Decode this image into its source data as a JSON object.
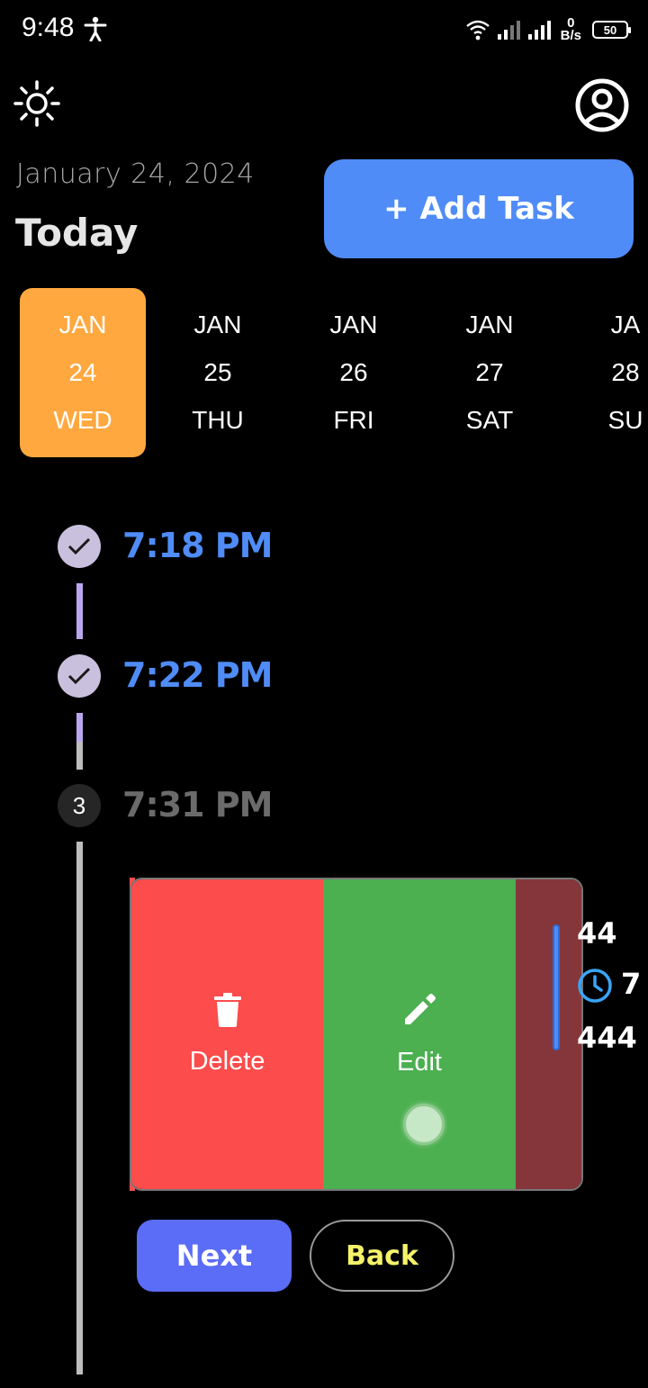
{
  "status_bar": {
    "time": "9:48",
    "net_speed_value": "0",
    "net_speed_unit": "B/s",
    "battery": "50"
  },
  "header": {
    "date": "January 24, 2024",
    "title": "Today",
    "add_task_label": "+ Add Task"
  },
  "date_strip": {
    "items": [
      {
        "month": "JAN",
        "day": "24",
        "weekday": "WED",
        "selected": true
      },
      {
        "month": "JAN",
        "day": "25",
        "weekday": "THU",
        "selected": false
      },
      {
        "month": "JAN",
        "day": "26",
        "weekday": "FRI",
        "selected": false
      },
      {
        "month": "JAN",
        "day": "27",
        "weekday": "SAT",
        "selected": false
      },
      {
        "month": "JA",
        "day": "28",
        "weekday": "SU",
        "selected": false
      }
    ]
  },
  "timeline": {
    "steps": [
      {
        "time": "7:18 PM",
        "status": "done"
      },
      {
        "time": "7:22 PM",
        "status": "done"
      },
      {
        "number": "3",
        "time": "7:31 PM",
        "status": "pending"
      }
    ]
  },
  "task_card": {
    "delete_label": "Delete",
    "edit_label": "Edit",
    "title_peek": "44",
    "time_peek": "7",
    "desc_peek": "444"
  },
  "showcase": {
    "next_label": "Next",
    "back_label": "Back"
  },
  "colors": {
    "accent_blue": "#4f8cf7",
    "selected_date": "#ffa83f",
    "delete_red": "#fc4c4c",
    "edit_green": "#4caf50",
    "back_text_yellow": "#f5f26a"
  }
}
